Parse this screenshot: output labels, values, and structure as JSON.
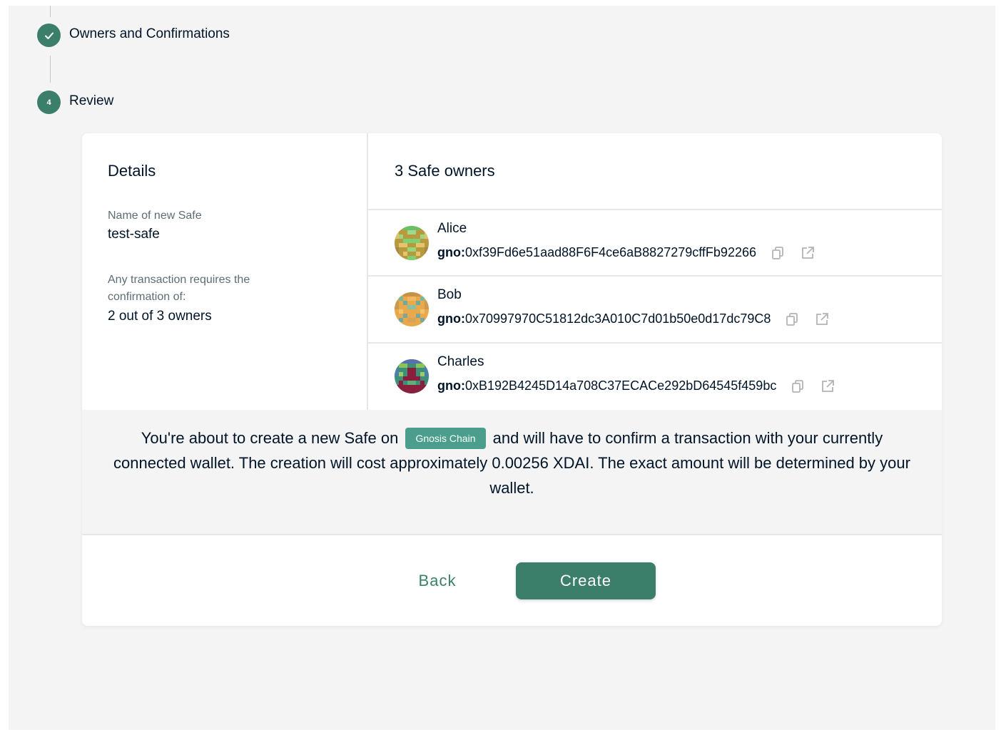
{
  "stepper": {
    "steps": [
      {
        "label": "Owners and Confirmations",
        "status": "completed",
        "icon": "check-icon"
      },
      {
        "label": "Review",
        "number": "4",
        "status": "active"
      }
    ]
  },
  "details": {
    "title": "Details",
    "name_label": "Name of new Safe",
    "name_value": "test-safe",
    "threshold_label": "Any transaction requires the confirmation of:",
    "threshold_value": "2 out of 3 owners"
  },
  "owners": {
    "title": "3 Safe owners",
    "items": [
      {
        "name": "Alice",
        "prefix": "gno:",
        "address": "0xf39Fd6e51aad88F6F4ce6aB8827279cffFb92266"
      },
      {
        "name": "Bob",
        "prefix": "gno:",
        "address": "0x70997970C51812dc3A010C7d01b50e0d17dc79C8"
      },
      {
        "name": "Charles",
        "prefix": "gno:",
        "address": "0xB192B4245D14a708C37ECACe292bD64545f459bc"
      }
    ]
  },
  "notice": {
    "text_before": "You're about to create a new Safe on",
    "chain_name": "Gnosis Chain",
    "text_after": "and will have to confirm a transaction with your currently connected wallet. The creation will cost approximately 0.00256 XDAI. The exact amount will be determined by your wallet."
  },
  "actions": {
    "back_label": "Back",
    "create_label": "Create"
  },
  "colors": {
    "primary": "#3b7f6b",
    "chip": "#4a9e8b",
    "background": "#f4f4f4",
    "text": "#001428"
  }
}
